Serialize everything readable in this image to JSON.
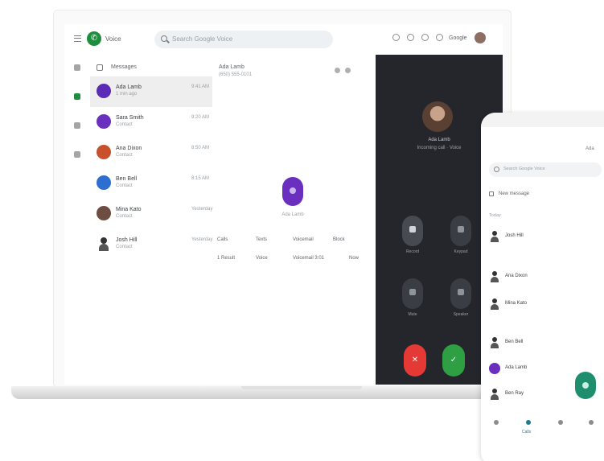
{
  "app": {
    "name": "Voice",
    "search_placeholder": "Search Google Voice",
    "account_label": "Google"
  },
  "list": {
    "header": "Messages",
    "rows": [
      {
        "name": "Ada Lamb",
        "sub": "1 min ago",
        "time": "9:41 AM",
        "avatar_color": "#5b2bb6"
      },
      {
        "name": "Sara Smith",
        "sub": "Contact",
        "time": "9:20 AM",
        "avatar_color": "#6a2fbf"
      },
      {
        "name": "Ana Dixon",
        "sub": "Contact",
        "time": "8:50 AM",
        "avatar_color": "#c8502d"
      },
      {
        "name": "Ben Bell",
        "sub": "Contact",
        "time": "8:15 AM",
        "avatar_color": "#2d6fd1"
      },
      {
        "name": "Mina Kato",
        "sub": "Contact",
        "time": "Yesterday",
        "avatar_color": "#6d4c41"
      },
      {
        "name": "Josh Hill",
        "sub": "Contact",
        "time": "Yesterday",
        "avatar_color": "person"
      }
    ]
  },
  "detail": {
    "title": "Ada Lamb",
    "subtitle": "(650) 555-0101",
    "avatar_label": "Ada Lamb",
    "tabs": [
      "Calls",
      "Texts",
      "Voicemail",
      "Block"
    ],
    "messages": [
      "1 Result",
      "Voice",
      "Voicemail 3:01",
      "Now"
    ]
  },
  "call": {
    "caller_name": "Ada Lamb",
    "status": "Incoming call · Voice",
    "controls": [
      {
        "label": "Record",
        "active": true
      },
      {
        "label": "Keypad",
        "active": false
      },
      {
        "label": "Mute",
        "active": false
      },
      {
        "label": "Speaker",
        "active": false
      }
    ],
    "decline_glyph": "✕",
    "answer_glyph": "✓"
  },
  "phone": {
    "account": "Ada",
    "search_placeholder": "Search Google Voice",
    "new_message": "New message",
    "section": "Today",
    "contacts": [
      {
        "name": "Josh Hill",
        "avatar": "person"
      },
      {
        "name": "Ana Dixon",
        "avatar": "person"
      },
      {
        "name": "Mina Kato",
        "avatar": "person"
      },
      {
        "name": "Ben Bell",
        "avatar": "person"
      },
      {
        "name": "Ada Lamb",
        "avatar": "purple"
      },
      {
        "name": "Ben Ray",
        "avatar": "person"
      }
    ],
    "nav_active_label": "Calls"
  }
}
